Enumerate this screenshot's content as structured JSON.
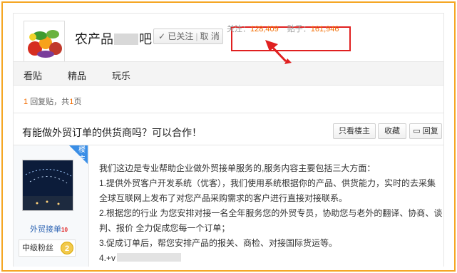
{
  "forum": {
    "name_prefix": "农产品",
    "name_suffix": "吧",
    "follow_label": "✓ 已关注",
    "unfollow_label": "取 消",
    "followers_label": "关注：",
    "followers_count": "128,409",
    "posts_label": "贴子：",
    "posts_count": "161,946"
  },
  "nav": {
    "items": [
      {
        "label": "看贴"
      },
      {
        "label": "精品"
      },
      {
        "label": "玩乐"
      }
    ]
  },
  "pager": {
    "reply_count": "1",
    "reply_text": "回复贴，共",
    "pages_count": "1",
    "pages_text": "页"
  },
  "thread": {
    "title": "有能做外贸订单的供货商吗？可以合作！",
    "buttons": {
      "only_op": "只看楼主",
      "favorite": "收藏",
      "reply": "回复"
    }
  },
  "post": {
    "author": {
      "name": "外贸接单",
      "vip_label": "10",
      "badge": "楼主",
      "level_title": "中级粉丝",
      "level": "2"
    },
    "lines": [
      "我们这边是专业帮助企业做外贸接单服务的,服务内容主要包括三大方面：",
      "1.提供外贸客户开发系统（优客），我们使用系统根据你的产品、供货能力，实时的去采集",
      "全球互联网上发布了对您产品采购需求的客户进行直接对接联系。",
      "2.根据您的行业 为您安排对接一名全年服务您的外贸专员，协助您与老外的翻译、协商、谈",
      "判、报价 全力促成您每一个订单；",
      "3.促成订单后，帮您安排产品的报关、商检、对接国际货运等。",
      "4.+v"
    ]
  },
  "colors": {
    "highlight": "#e02020",
    "accent": "#f36c00",
    "link": "#2d64b3",
    "frame": "#f5a623"
  }
}
